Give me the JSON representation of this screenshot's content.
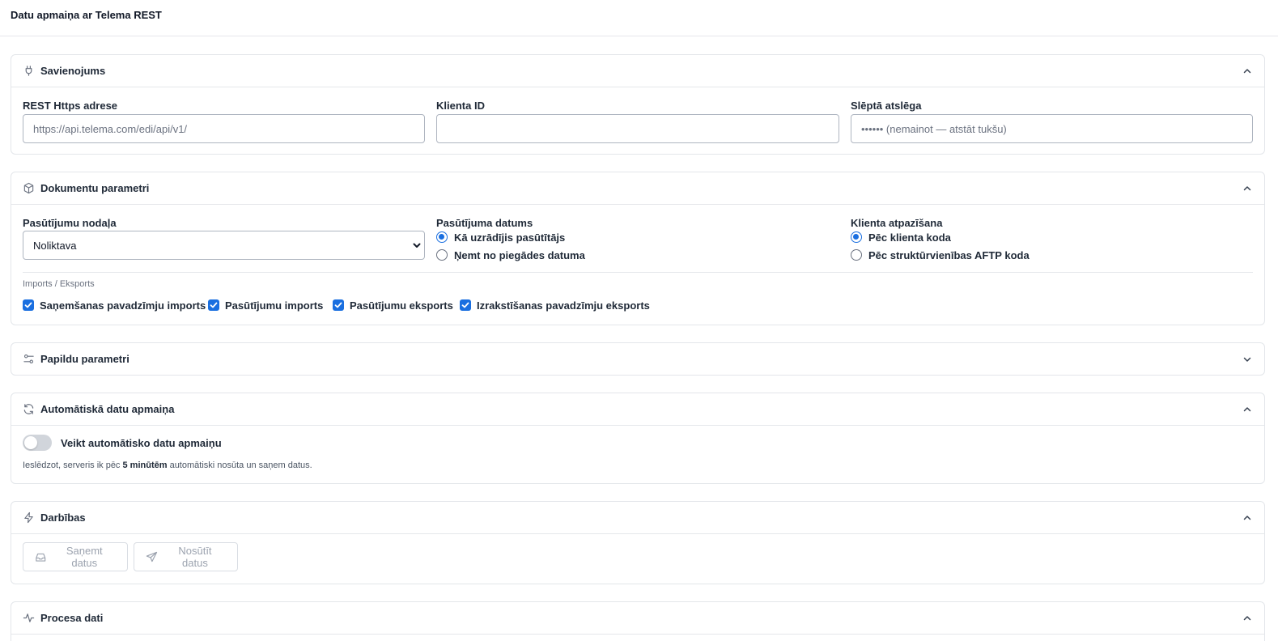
{
  "page": {
    "title": "Datu apmaiņa ar Telema REST"
  },
  "connection": {
    "title": "Savienojums",
    "url_label": "REST Https adrese",
    "url_placeholder": "https://api.telema.com/edi/api/v1/",
    "url_value": "",
    "client_id_label": "Klienta ID",
    "client_id_value": "",
    "secret_label": "Slēptā atslēga",
    "secret_placeholder": "•••••• (nemainot — atstāt tukšu)",
    "secret_value": ""
  },
  "documents": {
    "title": "Dokumentu parametri",
    "department_label": "Pasūtījumu nodaļa",
    "department_selected": "Noliktava",
    "order_date_label": "Pasūtījuma datums",
    "order_date_options": [
      {
        "label": "Kā uzrādījis pasūtītājs",
        "checked": true
      },
      {
        "label": "Ņemt no piegādes datuma",
        "checked": false
      }
    ],
    "client_recognition_label": "Klienta atpazīšana",
    "client_recognition_options": [
      {
        "label": "Pēc klienta koda",
        "checked": true
      },
      {
        "label": "Pēc struktūrvienības AFTP koda",
        "checked": false
      }
    ],
    "import_export_label": "Imports / Eksports",
    "import_export_options": [
      {
        "label": "Saņemšanas pavadzīmju imports",
        "checked": true
      },
      {
        "label": "Pasūtījumu imports",
        "checked": true
      },
      {
        "label": "Pasūtījumu eksports",
        "checked": true
      },
      {
        "label": "Izrakstīšanas pavadzīmju eksports",
        "checked": true
      }
    ]
  },
  "additional": {
    "title": "Papildu parametri"
  },
  "auto": {
    "title": "Automātiskā datu apmaiņa",
    "toggle_label": "Veikt automātisko datu apmaiņu",
    "toggle_on": false,
    "hint_before": "Ieslēdzot, serveris ik pēc ",
    "hint_bold": "5 minūtēm",
    "hint_after": " automātiski nosūta un saņem datus."
  },
  "actions": {
    "title": "Darbības",
    "receive_label": "Saņemt datus",
    "send_label": "Nosūtīt datus"
  },
  "process": {
    "title": "Procesa dati"
  },
  "colors": {
    "accent": "#1a6fe0",
    "border": "#e3e6ea",
    "muted": "#9ca3af"
  }
}
